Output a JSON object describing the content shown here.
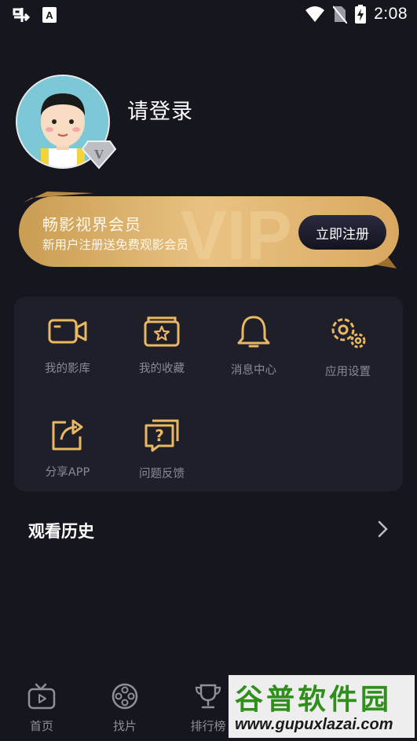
{
  "status_bar": {
    "time": "2:08"
  },
  "profile": {
    "login_text": "请登录",
    "badge_letter": "V"
  },
  "vip": {
    "title": "畅影视界会员",
    "subtitle": "新用户注册送免费观影会员",
    "register_button": "立即注册",
    "bg_text": "VIP"
  },
  "menu": {
    "items": [
      {
        "label": "我的影库",
        "icon": "camera-icon"
      },
      {
        "label": "我的收藏",
        "icon": "star-folder-icon"
      },
      {
        "label": "消息中心",
        "icon": "bell-icon"
      },
      {
        "label": "应用设置",
        "icon": "gear-icon"
      },
      {
        "label": "分享APP",
        "icon": "share-icon"
      },
      {
        "label": "问题反馈",
        "icon": "question-icon"
      }
    ]
  },
  "history": {
    "title": "观看历史"
  },
  "tabbar": {
    "tabs": [
      {
        "label": "首页",
        "icon": "tv-icon"
      },
      {
        "label": "找片",
        "icon": "film-reel-icon"
      },
      {
        "label": "排行榜",
        "icon": "trophy-icon"
      }
    ]
  },
  "watermark": {
    "text": "谷普软件园",
    "url": "www.gupuxlazai.com"
  },
  "colors": {
    "accent_gold": "#e8b863",
    "background": "#16161f",
    "card": "#1f1f2a"
  }
}
